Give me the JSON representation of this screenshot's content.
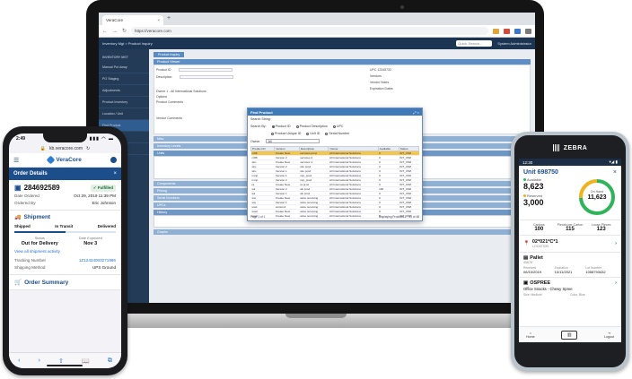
{
  "laptop": {
    "browser": {
      "tab_title": "VeraCore",
      "tab_close": "×",
      "new_tab": "+",
      "nav_back": "←",
      "nav_forward": "→",
      "nav_reload": "↻",
      "url": "https://veracore.com"
    },
    "app": {
      "breadcrumb": "Inventory Mgt > Product Inquiry",
      "search_placeholder": "Quick Search...",
      "user": "System Administrator",
      "sidebar_heading": "INVENTORY MGT",
      "sidebar_items": [
        "Manual Put Away",
        "PO Staging",
        "Adjustments",
        "Product Inventory",
        "Location / Unit",
        "Find Product",
        "Lots Reports",
        "Lots"
      ],
      "active_tab": "Product Inquiry",
      "panel_title": "Product Viewer",
      "fields": {
        "product_id": "Product ID",
        "description": "Description",
        "owner": "Owner",
        "options": "Options",
        "product_comments": "Product Comments",
        "vendor_comments": "Vendor Comments",
        "upc": "UPC",
        "vendors": "Vendors",
        "vendor_notes": "Vendor Notes",
        "expiration_dates": "Expiration Dates"
      },
      "owner_value": "1 - All International Solutions",
      "upc_value": "12345732",
      "sections": [
        "Misc",
        "Inventory Levels",
        "Units",
        "Components",
        "Pricing",
        "Serial Numbers",
        "UPCs",
        "History",
        "Graphs"
      ]
    },
    "dialog": {
      "title": "Find Product",
      "controls": "⤢ ×",
      "search_string_label": "Search String:",
      "search_by_label": "Search By:",
      "options": [
        "Product ID",
        "Product Description",
        "UPC",
        "Product Unique ID",
        "Unit ID",
        "Serial Number"
      ],
      "owner_label": "Owner",
      "owner_value": "All",
      "columns": [
        "Product ID",
        "Version",
        "Description",
        "Owner",
        "Available",
        "Status"
      ],
      "rows": [
        [
          "cr88",
          "Create New",
          "services prod",
          "All International Solutions",
          "0",
          "INT_OWI"
        ],
        [
          "cr88",
          "Version 2",
          "services 2",
          "All International Solutions",
          "0",
          "INT_OWI"
        ],
        [
          "sku",
          "Create New",
          "services 1",
          "All International Solutions",
          "0",
          "INT_OWI"
        ],
        [
          "sku",
          "Version 2",
          "sku prod",
          "All International Solutions",
          "0",
          "INT_OWI"
        ],
        [
          "sku",
          "Version 1",
          "sku prod",
          "All International Solutions",
          "0",
          "INT_OWI"
        ],
        [
          "nsnp",
          "Version 1",
          "nsp_prod",
          "All International Solutions",
          "0",
          "INT_OWI"
        ],
        [
          "nsnp",
          "Version 2",
          "nsp_prod",
          "All International Solutions",
          "0",
          "INT_OWI"
        ],
        [
          "ra",
          "Create New",
          "ra prod",
          "All International Solutions",
          "0",
          "INT_OWI"
        ],
        [
          "wk",
          "Version 2",
          "wk prod",
          "All International Solutions",
          "100",
          "INT_OWI"
        ],
        [
          "wk",
          "Version 1",
          "wk prod",
          "All International Solutions",
          "0",
          "INT_OWI"
        ],
        [
          "ww",
          "Create New",
          "www receiving",
          "All International Solutions",
          "0",
          "INT_OWI"
        ],
        [
          "ww",
          "Version 1",
          "www receiving",
          "All International Solutions",
          "0",
          "INT_OWI"
        ],
        [
          "ww1",
          "version1",
          "www receiving",
          "All International Solutions",
          "0",
          "INT_OWI"
        ],
        [
          "ww2",
          "Create New",
          "www receiving",
          "All International Solutions",
          "0",
          "INT_OWI"
        ],
        [
          "ww3",
          "Create New",
          "www receiving",
          "All International Solutions",
          "0",
          "INT_OWI"
        ]
      ],
      "pager": "Page 1 of 1",
      "count": "Displaying Products 1 - 23 of 48"
    }
  },
  "iphone": {
    "time": "2:49",
    "signal": "▮▮▮ ◠ ▬",
    "url": "kb.veracore.com",
    "lock": "🔒",
    "reload": "↻",
    "brand": "VeraCore",
    "menu": "☰",
    "header_title": "Order Details",
    "close": "×",
    "order_number": "284692589",
    "order_icon": "▣",
    "status_badge": "✓ Fulfilled",
    "date_ordered_label": "Date Ordered",
    "date_ordered": "Oct 29, 2019 11:39 PM",
    "ordered_by_label": "Ordered By",
    "ordered_by": "Eric Johnson",
    "shipment_title": "Shipment",
    "truck": "🚚",
    "steps": [
      "Shipped",
      "In Transit",
      "Delivered"
    ],
    "status_label": "Status",
    "status_value": "Out for Delivery",
    "expected_label": "Date Expected",
    "expected_value": "Nov 3",
    "activity_link": "View all shipment activity",
    "tracking_label": "Tracking Number",
    "tracking_value": "1Z12434003271986",
    "method_label": "Shipping Method",
    "method_value": "UPS Ground",
    "order_summary": "Order Summary",
    "summary_icon": "🛒",
    "tabbar": [
      "‹",
      "›",
      "⇧",
      "📖",
      "⧉"
    ],
    "progress_fraction": 0.5
  },
  "zebra": {
    "brand": "ZEBRA",
    "time": "12:30",
    "signal": "▾◢ ▮",
    "unit_title": "Unit 698750",
    "close": "×",
    "available_label": "Available",
    "available_value": "8,623",
    "reserved_label": "Reserved",
    "reserved_value": "3,000",
    "on_hand_label": "On Hand",
    "on_hand_value": "11,623",
    "available_color": "#2fb45a",
    "reserved_color": "#f2b21b",
    "row3": [
      {
        "label": "Cartons",
        "value": "100"
      },
      {
        "label": "Pieces per Carton",
        "value": "115"
      },
      {
        "label": "Loose Pieces",
        "value": "123"
      }
    ],
    "location_icon": "📍",
    "location_code": "02*021*C*1",
    "location_sub": "LOCATION",
    "chevron": "›",
    "pallet_icon": "▤",
    "pallet_title": "Pallet",
    "pallet_id": "45678",
    "pallet_cols": [
      {
        "label": "Received",
        "value": "06/10/2019"
      },
      {
        "label": "Expiration",
        "value": "10/11/2021"
      },
      {
        "label": "Lot Number",
        "value": "1058793432"
      }
    ],
    "product_icon": "▣",
    "product_title": "OSPREE",
    "product_desc": "Office Snacks - Chewy Spree",
    "product_size_label": "Size: Medium",
    "product_color_label": "Color: Blue",
    "nav_home": "Home",
    "nav_home_icon": "⌂",
    "nav_scan_icon": "▥",
    "nav_logout": "Logout",
    "nav_logout_icon": "⇥"
  }
}
